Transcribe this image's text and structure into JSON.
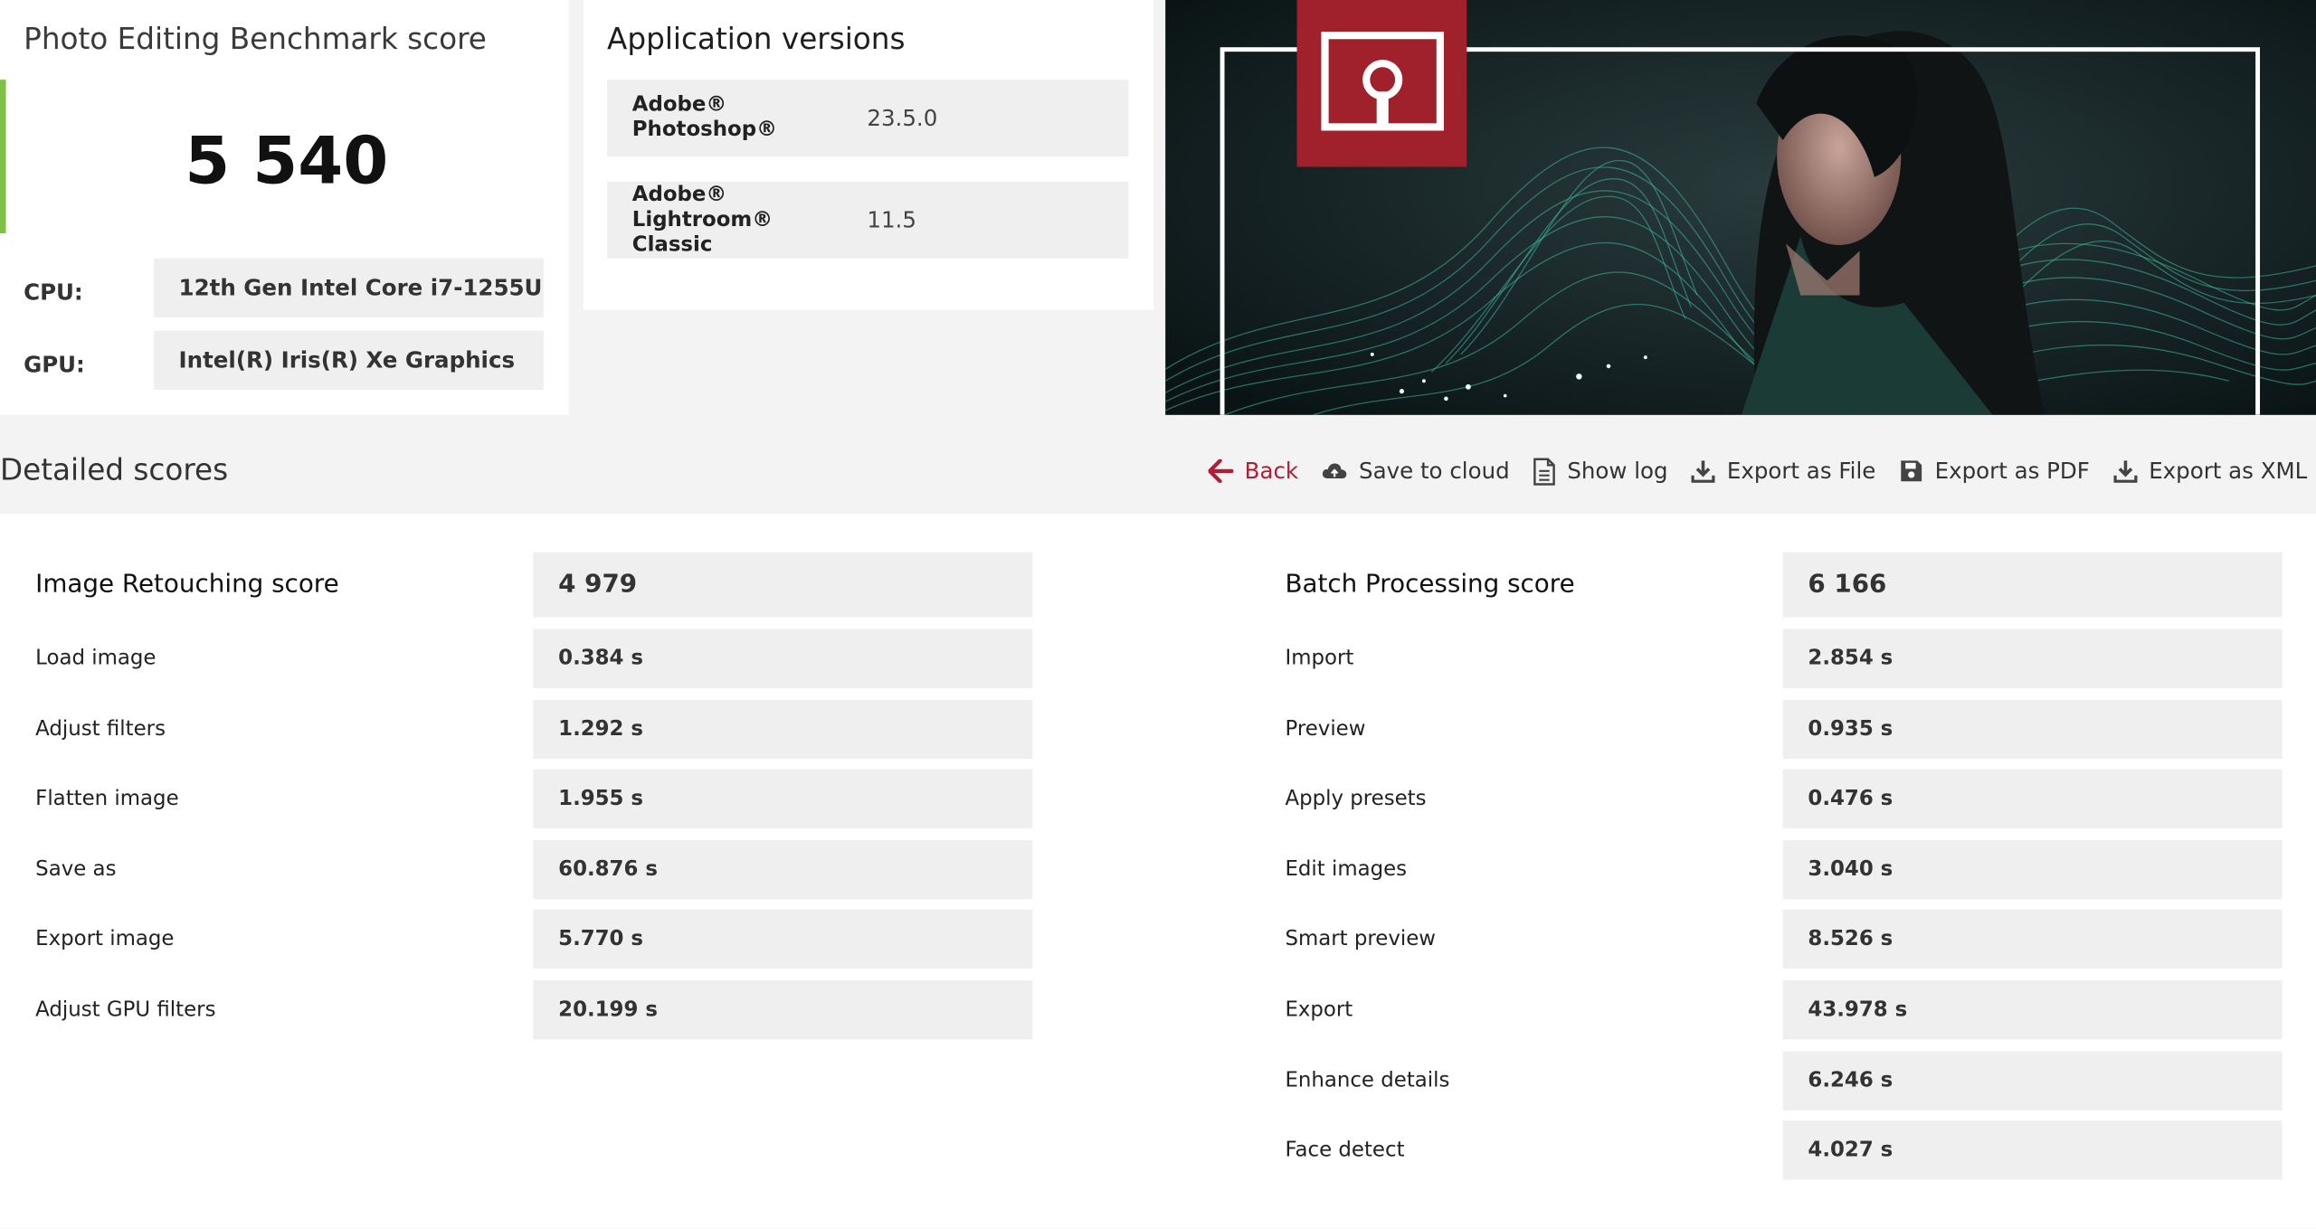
{
  "score_card": {
    "title": "Photo Editing Benchmark score",
    "score": "5 540",
    "cpu_label": "CPU:",
    "cpu_value": "12th Gen Intel Core i7-1255U",
    "gpu_label": "GPU:",
    "gpu_value": "Intel(R) Iris(R) Xe Graphics",
    "accent_color": "#7dc242"
  },
  "app_versions": {
    "title": "Application versions",
    "apps": [
      {
        "name_line1": "Adobe®",
        "name_line2": "Photoshop®",
        "version": "23.5.0"
      },
      {
        "name_line1": "Adobe®",
        "name_line2": "Lightroom® Classic",
        "version": "11.5"
      }
    ]
  },
  "hero": {
    "logo_icon": "benchmark-logo-icon",
    "brand_color": "#a0202b"
  },
  "detailed": {
    "title": "Detailed scores",
    "actions": [
      {
        "label": "Back",
        "icon": "arrow-left-icon"
      },
      {
        "label": "Save to cloud",
        "icon": "cloud-upload-icon"
      },
      {
        "label": "Show log",
        "icon": "document-icon"
      },
      {
        "label": "Export as File",
        "icon": "download-icon"
      },
      {
        "label": "Export as PDF",
        "icon": "save-icon"
      },
      {
        "label": "Export as XML",
        "icon": "download-icon"
      }
    ]
  },
  "image_retouching": {
    "title": "Image Retouching score",
    "score": "4 979",
    "items": [
      {
        "label": "Load image",
        "value": "0.384 s"
      },
      {
        "label": "Adjust filters",
        "value": "1.292 s"
      },
      {
        "label": "Flatten image",
        "value": "1.955 s"
      },
      {
        "label": "Save as",
        "value": "60.876 s"
      },
      {
        "label": "Export image",
        "value": "5.770 s"
      },
      {
        "label": "Adjust GPU filters",
        "value": "20.199 s"
      }
    ]
  },
  "batch_processing": {
    "title": "Batch Processing score",
    "score": "6 166",
    "items": [
      {
        "label": "Import",
        "value": "2.854 s"
      },
      {
        "label": "Preview",
        "value": "0.935 s"
      },
      {
        "label": "Apply presets",
        "value": "0.476 s"
      },
      {
        "label": "Edit images",
        "value": "3.040 s"
      },
      {
        "label": "Smart preview",
        "value": "8.526 s"
      },
      {
        "label": "Export",
        "value": "43.978 s"
      },
      {
        "label": "Enhance details",
        "value": "6.246 s"
      },
      {
        "label": "Face detect",
        "value": "4.027 s"
      }
    ]
  }
}
